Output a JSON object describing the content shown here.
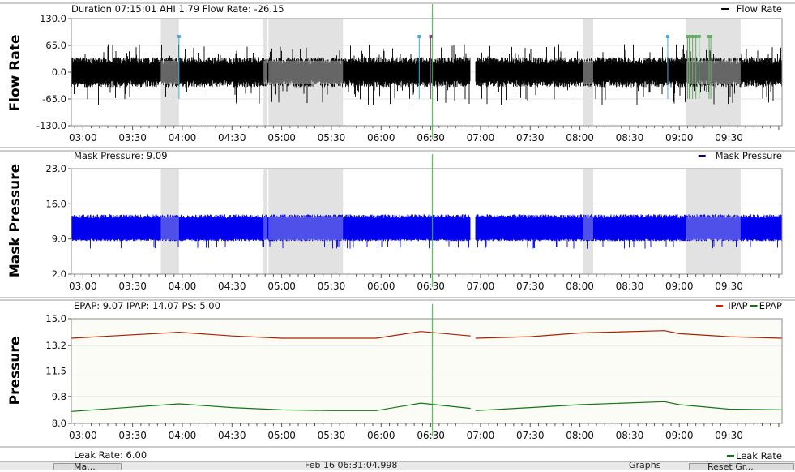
{
  "time_ticks": [
    "03:00",
    "03:30",
    "04:00",
    "04:30",
    "05:00",
    "05:30",
    "06:00",
    "06:30",
    "07:00",
    "07:30",
    "08:00",
    "08:30",
    "09:00",
    "09:30"
  ],
  "chart_data": [
    {
      "type": "area",
      "title": "Duration 07:15:01 AHI 1.79 Flow Rate: -26.15",
      "ylabel": "Flow Rate",
      "ylim": [
        -130,
        130
      ],
      "yticks": [
        "130.0",
        "65.0",
        "0.0",
        "-65.0",
        "-130.0"
      ],
      "xlim": [
        "02:53",
        "10:02"
      ],
      "legend": [
        {
          "name": "Flow Rate",
          "color": "#000000"
        }
      ],
      "legend_position": "top-right",
      "series": [
        {
          "name": "Flow Rate",
          "color": "#000000",
          "envelope_upper": 28,
          "envelope_lower": -28
        }
      ],
      "gap": [
        "06:54",
        "06:57"
      ],
      "shaded_regions": [
        [
          "03:47",
          "03:58"
        ],
        [
          "04:49",
          "04:51"
        ],
        [
          "04:52",
          "05:37"
        ],
        [
          "08:02",
          "08:08"
        ],
        [
          "09:04",
          "09:37"
        ]
      ],
      "event_markers": [
        {
          "time": "03:58",
          "color": "#44aadd"
        },
        {
          "time": "06:23",
          "color": "#44aadd"
        },
        {
          "time": "06:30",
          "color": "#993399"
        },
        {
          "time": "08:53",
          "color": "#44aadd"
        },
        {
          "time": "09:05",
          "color": "#66aa66"
        },
        {
          "time": "09:06",
          "color": "#66aa66"
        },
        {
          "time": "09:08",
          "color": "#66aa66"
        },
        {
          "time": "09:10",
          "color": "#66aa66"
        },
        {
          "time": "09:12",
          "color": "#66aa66"
        },
        {
          "time": "09:18",
          "color": "#66aa66"
        },
        {
          "time": "09:19",
          "color": "#66aa66"
        }
      ],
      "cursor": "06:31"
    },
    {
      "type": "area",
      "title": "Mask Pressure: 9.09",
      "ylabel": "Mask Pressure",
      "ylim": [
        2,
        23
      ],
      "yticks": [
        "23.0",
        "16.0",
        "9.0",
        "2.0"
      ],
      "xlim": [
        "02:53",
        "10:02"
      ],
      "legend": [
        {
          "name": "Mask Pressure",
          "color": "#00008b"
        }
      ],
      "legend_position": "top-right",
      "series": [
        {
          "name": "Mask Pressure",
          "color": "#0000ee",
          "band_upper": 13.5,
          "band_lower": 8.8
        }
      ],
      "gap": [
        "06:54",
        "06:57"
      ],
      "shaded_regions": [
        [
          "03:47",
          "03:58"
        ],
        [
          "04:49",
          "04:51"
        ],
        [
          "04:52",
          "05:37"
        ],
        [
          "08:02",
          "08:08"
        ],
        [
          "09:04",
          "09:37"
        ]
      ],
      "cursor": "06:31"
    },
    {
      "type": "line",
      "title": "EPAP: 9.07 IPAP: 14.07 PS: 5.00",
      "ylabel": "Pressure",
      "ylim": [
        8,
        15
      ],
      "yticks": [
        "15.0",
        "13.2",
        "11.5",
        "9.8",
        "8.0"
      ],
      "xlim": [
        "02:53",
        "10:02"
      ],
      "legend": [
        {
          "name": "IPAP",
          "color": "#cc2200"
        },
        {
          "name": "EPAP",
          "color": "#117711"
        }
      ],
      "legend_position": "top-right",
      "series": [
        {
          "name": "IPAP",
          "color": "#aa2200",
          "points": [
            [
              "02:53",
              13.7
            ],
            [
              "03:58",
              14.1
            ],
            [
              "04:30",
              13.85
            ],
            [
              "05:00",
              13.7
            ],
            [
              "05:30",
              13.7
            ],
            [
              "05:57",
              13.7
            ],
            [
              "06:24",
              14.15
            ],
            [
              "06:54",
              13.85
            ],
            [
              "06:57",
              13.7
            ],
            [
              "07:30",
              13.8
            ],
            [
              "08:00",
              14.05
            ],
            [
              "08:51",
              14.2
            ],
            [
              "09:00",
              14.0
            ],
            [
              "09:30",
              13.8
            ],
            [
              "10:02",
              13.7
            ]
          ]
        },
        {
          "name": "EPAP",
          "color": "#117711",
          "points": [
            [
              "02:53",
              8.8
            ],
            [
              "03:58",
              9.3
            ],
            [
              "04:30",
              9.05
            ],
            [
              "05:00",
              8.9
            ],
            [
              "05:30",
              8.85
            ],
            [
              "05:57",
              8.85
            ],
            [
              "06:24",
              9.35
            ],
            [
              "06:54",
              9.0
            ],
            [
              "06:57",
              8.85
            ],
            [
              "07:30",
              9.05
            ],
            [
              "08:00",
              9.25
            ],
            [
              "08:51",
              9.45
            ],
            [
              "09:00",
              9.25
            ],
            [
              "09:30",
              8.95
            ],
            [
              "10:02",
              8.9
            ]
          ]
        }
      ],
      "gap": [
        "06:54",
        "06:57"
      ],
      "cursor": "06:31"
    }
  ],
  "leak": {
    "title": "Leak Rate: 6.00",
    "legend": "Leak Rate"
  },
  "bottom": {
    "date": "Feb 16 06:31:04.998",
    "btn_label": "Ma...",
    "right_label": "Graphs",
    "right_btn": "Reset Gr..."
  }
}
